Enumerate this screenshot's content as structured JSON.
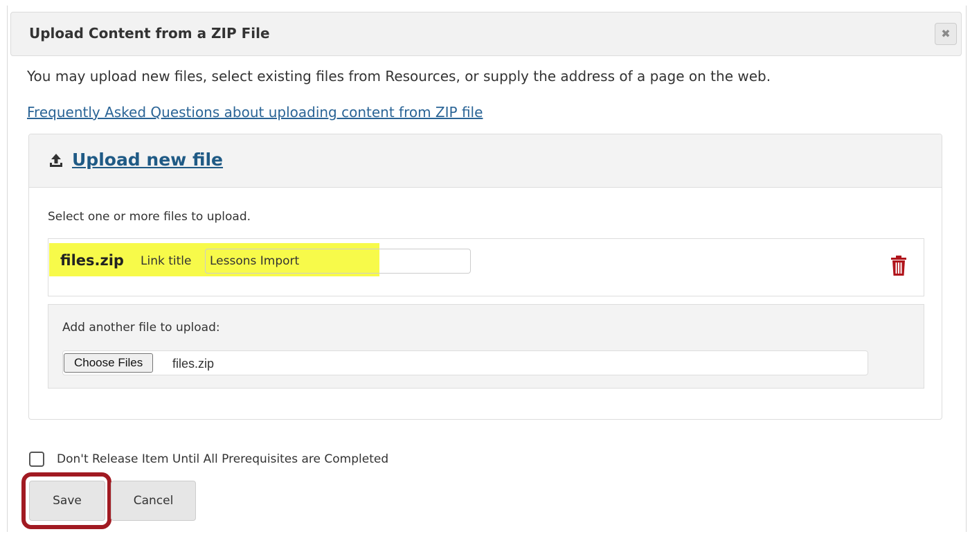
{
  "dialog": {
    "title": "Upload Content from a ZIP File",
    "close_icon": "close-icon",
    "intro": "You may upload new files, select existing files from Resources, or supply the address of a page on the web.",
    "faq_link": "Frequently Asked Questions about uploading content from ZIP file"
  },
  "upload_panel": {
    "heading_icon": "upload-icon",
    "heading_link": "Upload new file",
    "select_label": "Select one or more files to upload.",
    "file_item": {
      "file_name": "files.zip",
      "link_title_label": "Link title",
      "link_title_value": "Lessons Import",
      "delete_icon": "trash-icon"
    },
    "add_another": {
      "label": "Add another file to upload:",
      "choose_button": "Choose Files",
      "chosen_file": "files.zip"
    }
  },
  "options": {
    "prerequisite_checkbox_label": "Don't Release Item Until All Prerequisites are Completed",
    "prerequisite_checked": false
  },
  "actions": {
    "save_label": "Save",
    "cancel_label": "Cancel"
  },
  "colors": {
    "link": "#2a6496",
    "highlight": "#f7fa4a",
    "trash": "#b0141b",
    "annotation_outline": "#a11a22"
  }
}
